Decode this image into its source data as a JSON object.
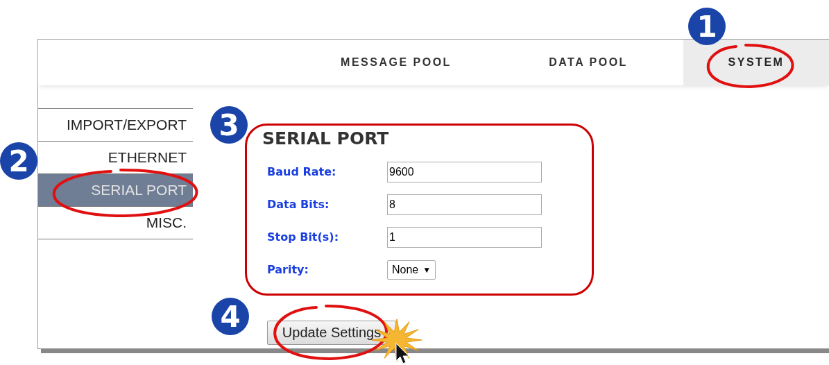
{
  "nav": {
    "tabs": [
      {
        "label": "MESSAGE POOL",
        "selected": false
      },
      {
        "label": "DATA POOL",
        "selected": false
      },
      {
        "label": "SYSTEM",
        "selected": true
      }
    ]
  },
  "sidebar": {
    "items": [
      {
        "label": "IMPORT/EXPORT",
        "selected": false
      },
      {
        "label": "ETHERNET",
        "selected": false
      },
      {
        "label": "SERIAL PORT",
        "selected": true
      },
      {
        "label": "MISC.",
        "selected": false
      }
    ]
  },
  "form": {
    "title": "SERIAL PORT",
    "fields": [
      {
        "kind": "text",
        "label": "Baud Rate:",
        "value": "9600"
      },
      {
        "kind": "text",
        "label": "Data Bits:",
        "value": "8"
      },
      {
        "kind": "text",
        "label": "Stop Bit(s):",
        "value": "1"
      },
      {
        "kind": "select",
        "label": "Parity:",
        "value": "None",
        "caret": "▼"
      }
    ],
    "button": "Update Settings"
  },
  "annotations": [
    {
      "number": "1"
    },
    {
      "number": "2"
    },
    {
      "number": "3"
    },
    {
      "number": "4"
    }
  ]
}
